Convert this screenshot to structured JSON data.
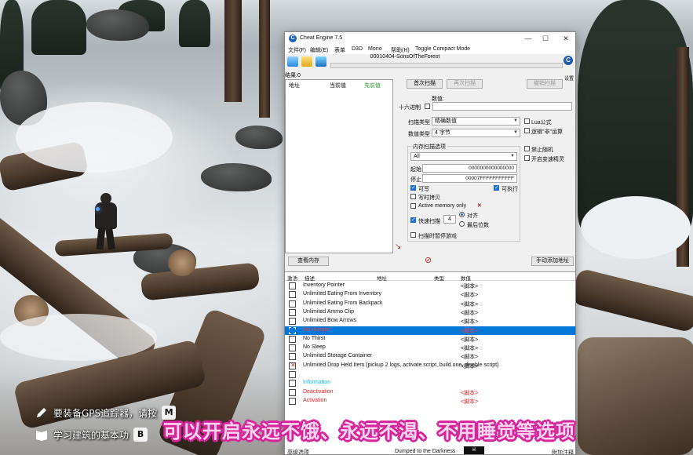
{
  "window": {
    "title": "Cheat Engine 7.5",
    "minimize": "—",
    "maximize": "☐",
    "close": "✕"
  },
  "menu": [
    "文件(F)",
    "编辑(E)",
    "表单",
    "D3D",
    "Mono",
    "帮助(H)",
    "Toggle Compact Mode"
  ],
  "process_title": "00010404-SonsOfTheForest",
  "settings_label": "设置",
  "found_label": "结果:0",
  "results_headers": [
    "地址",
    "当前值",
    "先前值"
  ],
  "scan": {
    "first_scan": "首次扫描",
    "next_scan": "再次扫描",
    "undo_scan": "撤销扫描",
    "value_label": "数值:",
    "hex_label": "十六进制",
    "scan_type_label": "扫描类型",
    "scan_type_value": "精确数值",
    "value_type_label": "数值类型",
    "value_type_value": "4 字节",
    "lua_formula": "Lua公式",
    "not_logic": "逻辑\"非\"运算",
    "disable_random": "禁止随机",
    "speed_hack": "开启变速精灵",
    "memory_options": "内存扫描选项",
    "memory_region": "All",
    "start_label": "起始",
    "start_value": "0000000000000000",
    "stop_label": "停止",
    "stop_value": "00007FFFFFFFFFFF",
    "writable": "可写",
    "executable": "可执行",
    "copy_on_write": "写时拷贝",
    "active_memory": "Active memory only",
    "fast_scan": "快速扫描",
    "fast_scan_value": "4",
    "align": "对齐",
    "last_digits": "最后位数",
    "pause_game": "扫描时暂停游戏"
  },
  "buttons": {
    "view_memory": "查看内存",
    "add_address": "手动添加地址"
  },
  "codelist": {
    "headers": [
      "激活",
      "描述",
      "地址",
      "类型",
      "数值"
    ],
    "rows": [
      {
        "desc": "Inventory Pointer",
        "val": "<脚本>",
        "kind": "normal"
      },
      {
        "desc": "Unlimited Eating From Inventory",
        "val": "<脚本>",
        "kind": "normal"
      },
      {
        "desc": "Unlimited Eating From Backpack",
        "val": "<脚本>",
        "kind": "normal"
      },
      {
        "desc": "Unlimited Ammo Clip",
        "val": "<脚本>",
        "kind": "normal"
      },
      {
        "desc": "Unlimited Bow Arrows",
        "val": "<脚本>",
        "kind": "normal"
      },
      {
        "desc": "No Hunger",
        "val": "<脚本>",
        "kind": "selected"
      },
      {
        "desc": "No Thirst",
        "val": "<脚本>",
        "kind": "normal"
      },
      {
        "desc": "No Sleep",
        "val": "<脚本>",
        "kind": "normal"
      },
      {
        "desc": "Unlimited Storage Container",
        "val": "<脚本>",
        "kind": "normal"
      },
      {
        "desc": "Unlimited Drop Held Item (pickup 2 logs, activate script, build one, disable script)",
        "val": "<脚本>",
        "kind": "crossed"
      },
      {
        "desc": "",
        "val": "",
        "kind": "empty"
      },
      {
        "desc": "Information",
        "val": "",
        "kind": "info"
      },
      {
        "desc": "Deactivation",
        "val": "<脚本>",
        "kind": "red"
      },
      {
        "desc": "Activation",
        "val": "<脚本>",
        "kind": "red"
      }
    ]
  },
  "statusbar": {
    "left": "高级选项",
    "center": "Dumped to the Darkness",
    "right": "附加注释"
  },
  "hints": {
    "gps_text": "要装备GPS追踪器，请按",
    "gps_key": "M",
    "build_text": "学习建筑的基本功",
    "build_key": "B"
  },
  "subtitle": "可以开启永远不饿、永远不渴、不用睡觉等选项",
  "colors": {
    "selection": "#0078d7",
    "script_red": "#e02020",
    "info_cyan": "#17b3d9",
    "subtitle_fill": "#ffd6f0",
    "subtitle_outline": "#d6249a"
  }
}
